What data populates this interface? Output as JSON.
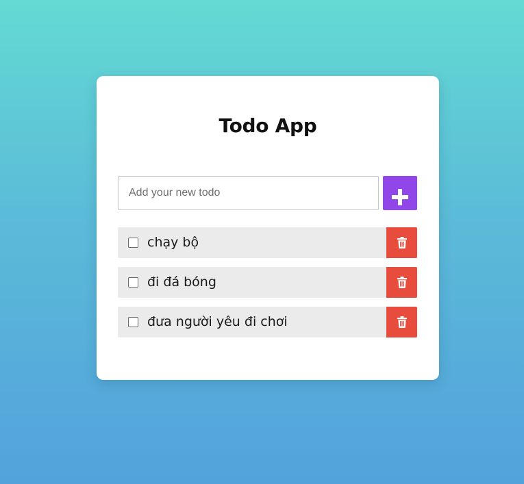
{
  "app": {
    "title": "Todo App"
  },
  "new_todo": {
    "placeholder": "Add your new todo",
    "value": "",
    "add_icon": "plus-icon"
  },
  "todos": [
    {
      "text": "chạy bộ",
      "done": false,
      "delete_icon": "trash-icon"
    },
    {
      "text": "đi đá bóng",
      "done": false,
      "delete_icon": "trash-icon"
    },
    {
      "text": "đưa người yêu đi chơi",
      "done": false,
      "delete_icon": "trash-icon"
    }
  ],
  "colors": {
    "accent": "#9146ea",
    "danger": "#e74c3c",
    "item_background": "#ebebeb",
    "gradient_top": "#63dad3",
    "gradient_bottom": "#53a2dc"
  }
}
